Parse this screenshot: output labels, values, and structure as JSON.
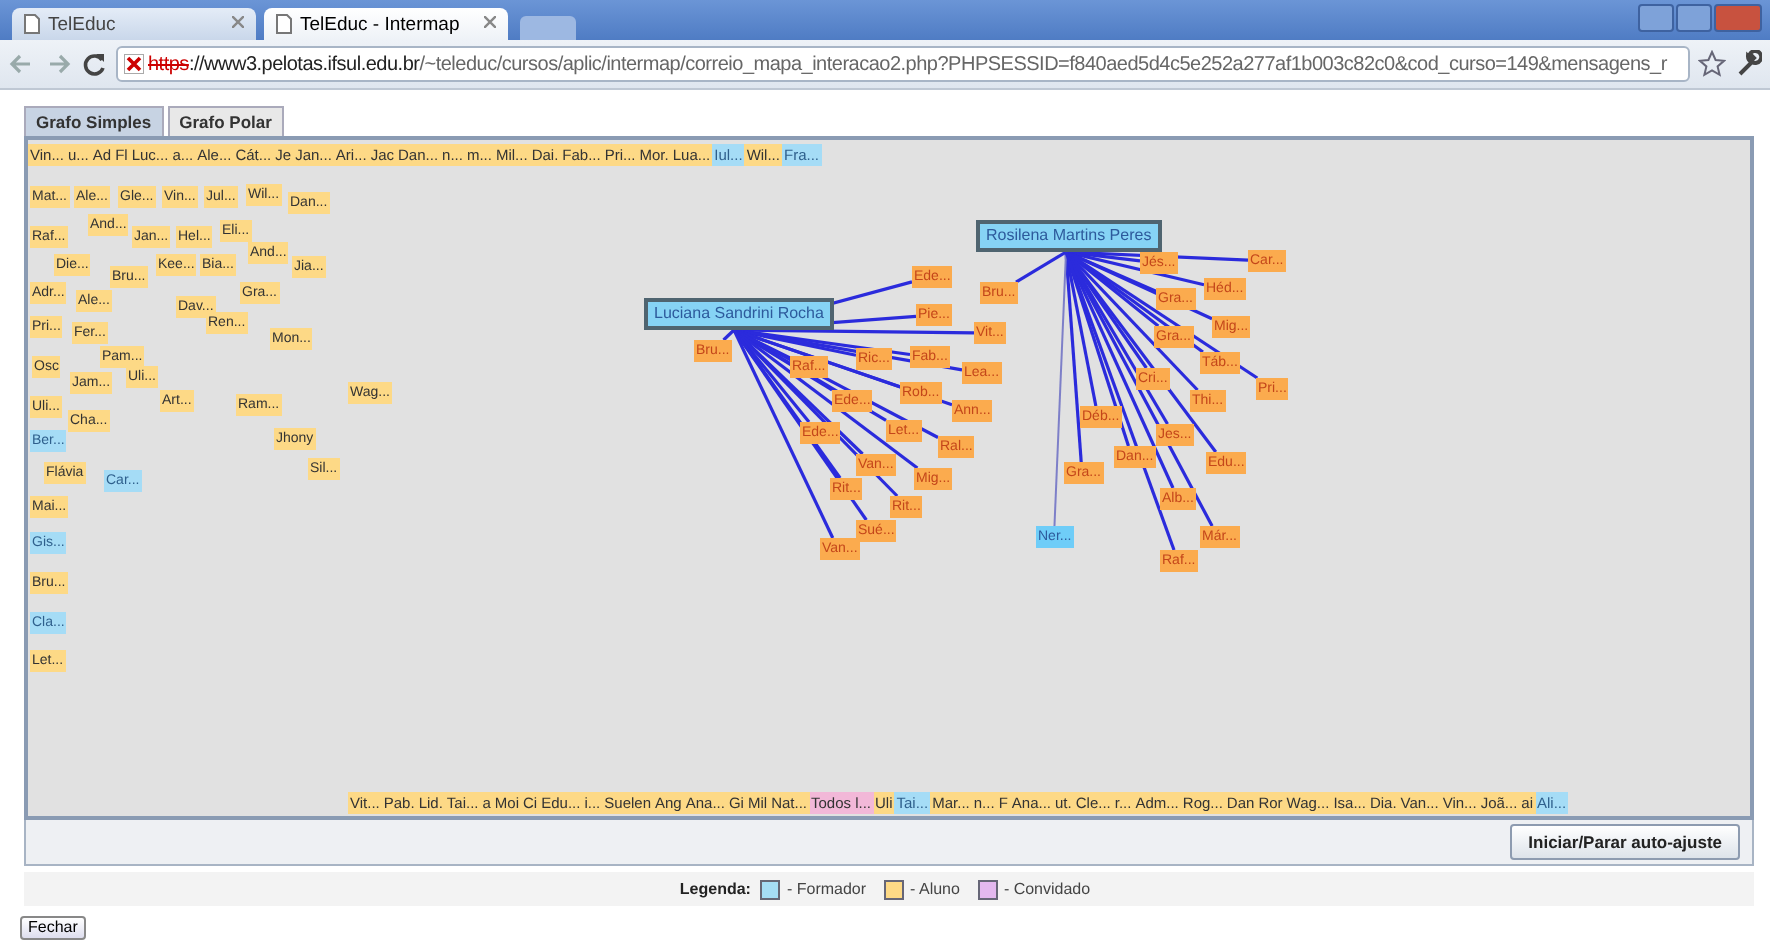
{
  "browser": {
    "tabs": [
      {
        "title": "TelEduc",
        "selected": false
      },
      {
        "title": "TelEduc - Intermap",
        "selected": true
      }
    ],
    "address": {
      "scheme": "https",
      "host": "://www3.pelotas.ifsul.edu.br",
      "path": "/~teleduc/cursos/aplic/intermap/correio_mapa_interacao2.php?PHPSESSID=f840aed5d4c5e252a277af1b003c82c0&cod_curso=149&mensagens_r"
    }
  },
  "applet": {
    "tabs": [
      {
        "label": "Grafo Simples",
        "selected": true
      },
      {
        "label": "Grafo Polar",
        "selected": false
      }
    ],
    "top_strip": [
      {
        "label": "Vin...",
        "kind": "aluno"
      },
      {
        "label": "u...",
        "kind": "aluno"
      },
      {
        "label": "Ad",
        "kind": "aluno"
      },
      {
        "label": "Fl",
        "kind": "aluno"
      },
      {
        "label": "Luc...",
        "kind": "aluno"
      },
      {
        "label": "a...",
        "kind": "aluno"
      },
      {
        "label": "Ale...",
        "kind": "aluno"
      },
      {
        "label": "Cát...",
        "kind": "aluno"
      },
      {
        "label": "Je",
        "kind": "aluno"
      },
      {
        "label": "Jan...",
        "kind": "aluno"
      },
      {
        "label": "Ari...",
        "kind": "aluno"
      },
      {
        "label": "Jac",
        "kind": "aluno"
      },
      {
        "label": "Dan...",
        "kind": "aluno"
      },
      {
        "label": "n...",
        "kind": "aluno"
      },
      {
        "label": "m...",
        "kind": "aluno"
      },
      {
        "label": "Mil...",
        "kind": "aluno"
      },
      {
        "label": "Dai.",
        "kind": "aluno"
      },
      {
        "label": "Fab...",
        "kind": "aluno"
      },
      {
        "label": "Pri...",
        "kind": "aluno"
      },
      {
        "label": "Mor.",
        "kind": "aluno"
      },
      {
        "label": "Lua...",
        "kind": "aluno"
      },
      {
        "label": "Iul...",
        "kind": "formador"
      },
      {
        "label": "Wil...",
        "kind": "aluno"
      },
      {
        "label": "Fra...",
        "kind": "formador"
      }
    ],
    "nodes": [
      {
        "label": "Mat...",
        "kind": "aluno",
        "connected": false
      },
      {
        "label": "Ale...",
        "kind": "aluno",
        "connected": false
      },
      {
        "label": "Gle...",
        "kind": "aluno",
        "connected": false
      },
      {
        "label": "Vin...",
        "kind": "aluno",
        "connected": false
      },
      {
        "label": "Jul...",
        "kind": "aluno",
        "connected": false
      },
      {
        "label": "Wil...",
        "kind": "aluno",
        "connected": false
      },
      {
        "label": "Dan...",
        "kind": "aluno",
        "connected": false
      },
      {
        "label": "Raf...",
        "kind": "aluno",
        "connected": false
      },
      {
        "label": "And...",
        "kind": "aluno",
        "connected": false
      },
      {
        "label": "Jan...",
        "kind": "aluno",
        "connected": false
      },
      {
        "label": "Hel...",
        "kind": "aluno",
        "connected": false
      },
      {
        "label": "Eli...",
        "kind": "aluno",
        "connected": false
      },
      {
        "label": "Die...",
        "kind": "aluno",
        "connected": false
      },
      {
        "label": "Kee...",
        "kind": "aluno",
        "connected": false
      },
      {
        "label": "Bia...",
        "kind": "aluno",
        "connected": false
      },
      {
        "label": "And...",
        "kind": "aluno",
        "connected": false
      },
      {
        "label": "Jia...",
        "kind": "aluno",
        "connected": false
      },
      {
        "label": "Bru...",
        "kind": "aluno",
        "connected": false
      },
      {
        "label": "Adr...",
        "kind": "aluno",
        "connected": false
      },
      {
        "label": "Ale...",
        "kind": "aluno",
        "connected": false
      },
      {
        "label": "Dav...",
        "kind": "aluno",
        "connected": false
      },
      {
        "label": "Gra...",
        "kind": "aluno",
        "connected": false
      },
      {
        "label": "Pri...",
        "kind": "aluno",
        "connected": false
      },
      {
        "label": "Fer...",
        "kind": "aluno",
        "connected": false
      },
      {
        "label": "Ren...",
        "kind": "aluno",
        "connected": false
      },
      {
        "label": "Mon...",
        "kind": "aluno",
        "connected": false
      },
      {
        "label": "Pam...",
        "kind": "aluno",
        "connected": false
      },
      {
        "label": "Osc",
        "kind": "aluno",
        "connected": false
      },
      {
        "label": "Jam...",
        "kind": "aluno",
        "connected": false
      },
      {
        "label": "Uli...",
        "kind": "aluno",
        "connected": false
      },
      {
        "label": "Wag...",
        "kind": "aluno",
        "connected": false
      },
      {
        "label": "Uli...",
        "kind": "aluno",
        "connected": false
      },
      {
        "label": "Art...",
        "kind": "aluno",
        "connected": false
      },
      {
        "label": "Ram...",
        "kind": "aluno",
        "connected": false
      },
      {
        "label": "Cha...",
        "kind": "aluno",
        "connected": false
      },
      {
        "label": "Ber...",
        "kind": "formador",
        "connected": false
      },
      {
        "label": "Jhony",
        "kind": "aluno",
        "connected": false
      },
      {
        "label": "Flávia",
        "kind": "aluno",
        "connected": false
      },
      {
        "label": "Car...",
        "kind": "formador",
        "connected": false
      },
      {
        "label": "Sil...",
        "kind": "aluno",
        "connected": false
      },
      {
        "label": "Mai...",
        "kind": "aluno",
        "connected": false
      },
      {
        "label": "Gis...",
        "kind": "formador",
        "connected": false
      },
      {
        "label": "Bru...",
        "kind": "aluno",
        "connected": false
      },
      {
        "label": "Cla...",
        "kind": "formador",
        "connected": false
      },
      {
        "label": "Let...",
        "kind": "aluno",
        "connected": false
      },
      {
        "label": "Luciana Sandrini Rocha",
        "kind": "formador",
        "connected": true
      },
      {
        "label": "Ede...",
        "kind": "aluno",
        "connected": true
      },
      {
        "label": "Pie...",
        "kind": "aluno",
        "connected": true
      },
      {
        "label": "Vit...",
        "kind": "aluno",
        "connected": true
      },
      {
        "label": "Bru...",
        "kind": "aluno",
        "connected": true
      },
      {
        "label": "Ric...",
        "kind": "aluno",
        "connected": true
      },
      {
        "label": "Fab...",
        "kind": "aluno",
        "connected": true
      },
      {
        "label": "Lea...",
        "kind": "aluno",
        "connected": true
      },
      {
        "label": "Raf...",
        "kind": "aluno",
        "connected": true
      },
      {
        "label": "Rob...",
        "kind": "aluno",
        "connected": true
      },
      {
        "label": "Ann...",
        "kind": "aluno",
        "connected": true
      },
      {
        "label": "Ede...",
        "kind": "aluno",
        "connected": true
      },
      {
        "label": "Let...",
        "kind": "aluno",
        "connected": true
      },
      {
        "label": "Ral...",
        "kind": "aluno",
        "connected": true
      },
      {
        "label": "Ede...",
        "kind": "aluno",
        "connected": true
      },
      {
        "label": "Van...",
        "kind": "aluno",
        "connected": true
      },
      {
        "label": "Mig...",
        "kind": "aluno",
        "connected": true
      },
      {
        "label": "Rit...",
        "kind": "aluno",
        "connected": true
      },
      {
        "label": "Rit...",
        "kind": "aluno",
        "connected": true
      },
      {
        "label": "Sué...",
        "kind": "aluno",
        "connected": true
      },
      {
        "label": "Van...",
        "kind": "aluno",
        "connected": true
      },
      {
        "label": "Rosilena Martins Peres",
        "kind": "formador",
        "connected": true
      },
      {
        "label": "Jés...",
        "kind": "aluno",
        "connected": true
      },
      {
        "label": "Car...",
        "kind": "aluno",
        "connected": true
      },
      {
        "label": "Bru...",
        "kind": "aluno",
        "connected": true
      },
      {
        "label": "Héd...",
        "kind": "aluno",
        "connected": true
      },
      {
        "label": "Gra...",
        "kind": "aluno",
        "connected": true
      },
      {
        "label": "Mig...",
        "kind": "aluno",
        "connected": true
      },
      {
        "label": "Gra...",
        "kind": "aluno",
        "connected": true
      },
      {
        "label": "Táb...",
        "kind": "aluno",
        "connected": true
      },
      {
        "label": "Cri...",
        "kind": "aluno",
        "connected": true
      },
      {
        "label": "Pri...",
        "kind": "aluno",
        "connected": true
      },
      {
        "label": "Thi...",
        "kind": "aluno",
        "connected": true
      },
      {
        "label": "Déb...",
        "kind": "aluno",
        "connected": true
      },
      {
        "label": "Jes...",
        "kind": "aluno",
        "connected": true
      },
      {
        "label": "Gra...",
        "kind": "aluno",
        "connected": true
      },
      {
        "label": "Dan...",
        "kind": "aluno",
        "connected": true
      },
      {
        "label": "Edu...",
        "kind": "aluno",
        "connected": true
      },
      {
        "label": "Alb...",
        "kind": "aluno",
        "connected": true
      },
      {
        "label": "Ner...",
        "kind": "formador",
        "connected": true
      },
      {
        "label": "Már...",
        "kind": "aluno",
        "connected": true
      },
      {
        "label": "Raf...",
        "kind": "aluno",
        "connected": true
      }
    ],
    "bottom_strip": [
      {
        "label": "Vit...",
        "kind": "aluno"
      },
      {
        "label": "Pab.",
        "kind": "aluno"
      },
      {
        "label": "Lid.",
        "kind": "aluno"
      },
      {
        "label": "Tai...",
        "kind": "aluno"
      },
      {
        "label": "a",
        "kind": "aluno"
      },
      {
        "label": "Moi",
        "kind": "aluno"
      },
      {
        "label": "Ci",
        "kind": "aluno"
      },
      {
        "label": "Edu...",
        "kind": "aluno"
      },
      {
        "label": "i...",
        "kind": "aluno"
      },
      {
        "label": "Suelen",
        "kind": "aluno"
      },
      {
        "label": "Ang",
        "kind": "aluno"
      },
      {
        "label": "Ana...",
        "kind": "aluno"
      },
      {
        "label": "Gi",
        "kind": "aluno"
      },
      {
        "label": "Mil",
        "kind": "aluno"
      },
      {
        "label": "Nat...",
        "kind": "aluno"
      },
      {
        "label": "Todos l...",
        "kind": "convidado"
      },
      {
        "label": "Uli",
        "kind": "aluno"
      },
      {
        "label": "Tai...",
        "kind": "formador"
      },
      {
        "label": "Mar...",
        "kind": "aluno"
      },
      {
        "label": "n...",
        "kind": "aluno"
      },
      {
        "label": "F",
        "kind": "aluno"
      },
      {
        "label": "Ana...",
        "kind": "aluno"
      },
      {
        "label": "ut.",
        "kind": "aluno"
      },
      {
        "label": "Cle...",
        "kind": "aluno"
      },
      {
        "label": "r...",
        "kind": "aluno"
      },
      {
        "label": "Adm...",
        "kind": "aluno"
      },
      {
        "label": "Rog...",
        "kind": "aluno"
      },
      {
        "label": "Dan",
        "kind": "aluno"
      },
      {
        "label": "Ror",
        "kind": "aluno"
      },
      {
        "label": "Wag...",
        "kind": "aluno"
      },
      {
        "label": "Isa...",
        "kind": "aluno"
      },
      {
        "label": "Dia.",
        "kind": "aluno"
      },
      {
        "label": "Van...",
        "kind": "aluno"
      },
      {
        "label": "Vin...",
        "kind": "aluno"
      },
      {
        "label": "Joã...",
        "kind": "aluno"
      },
      {
        "label": "ai",
        "kind": "aluno"
      },
      {
        "label": "Ali...",
        "kind": "formador"
      }
    ],
    "auto_adjust_button": "Iniciar/Parar auto-ajuste"
  },
  "legend": {
    "title": "Legenda:",
    "items": [
      {
        "label": "- Formador",
        "kind": "formador"
      },
      {
        "label": "- Aluno",
        "kind": "aluno"
      },
      {
        "label": "- Convidado",
        "kind": "convidado"
      }
    ]
  },
  "close_button": "Fechar"
}
